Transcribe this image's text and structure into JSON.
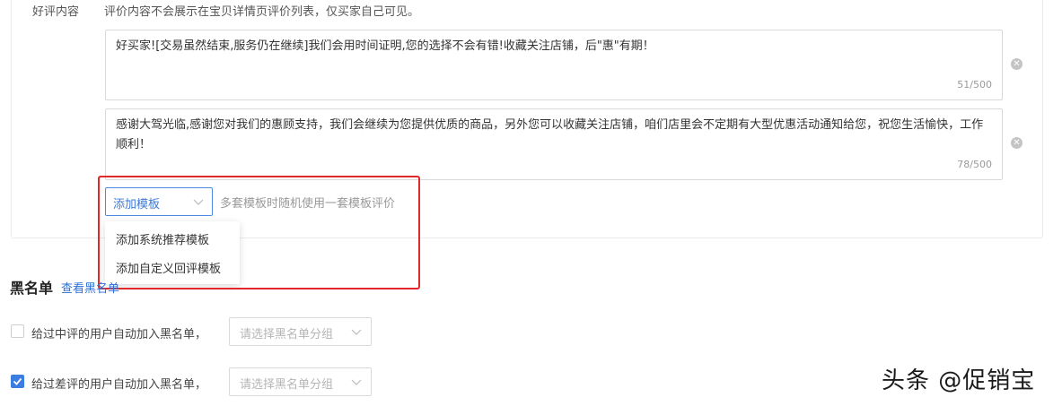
{
  "good_review": {
    "label": "好评内容",
    "hint": "评价内容不会展示在宝贝详情页评价列表，仅买家自己可见。",
    "templates": [
      {
        "text": "好买家![交易虽然结束,服务仍在继续]我们会用时间证明,您的选择不会有错!收藏关注店铺，后\"惠\"有期！",
        "counter": "51/500"
      },
      {
        "text": "感谢大驾光临,感谢您对我们的惠顾支持，我们会继续为您提供优质的商品，另外您可以收藏关注店铺，咱们店里会不定期有大型优惠活动通知给您，祝您生活愉快，工作顺利！",
        "counter": "78/500"
      }
    ],
    "add_template": {
      "label": "添加模板",
      "hint": "多套模板时随机使用一套模板评价",
      "options": [
        "添加系统推荐模板",
        "添加自定义回评模板"
      ]
    }
  },
  "blacklist": {
    "title": "黑名单",
    "view_link": "查看黑名单",
    "rules": [
      {
        "label": "给过中评的用户自动加入黑名单，",
        "checked": false,
        "group_placeholder": "请选择黑名单分组"
      },
      {
        "label": "给过差评的用户自动加入黑名单，",
        "checked": true,
        "group_placeholder": "请选择黑名单分组"
      }
    ]
  },
  "watermark": "头条 @促销宝",
  "colors": {
    "accent": "#3b7de0",
    "highlight_border": "#e0292b"
  }
}
